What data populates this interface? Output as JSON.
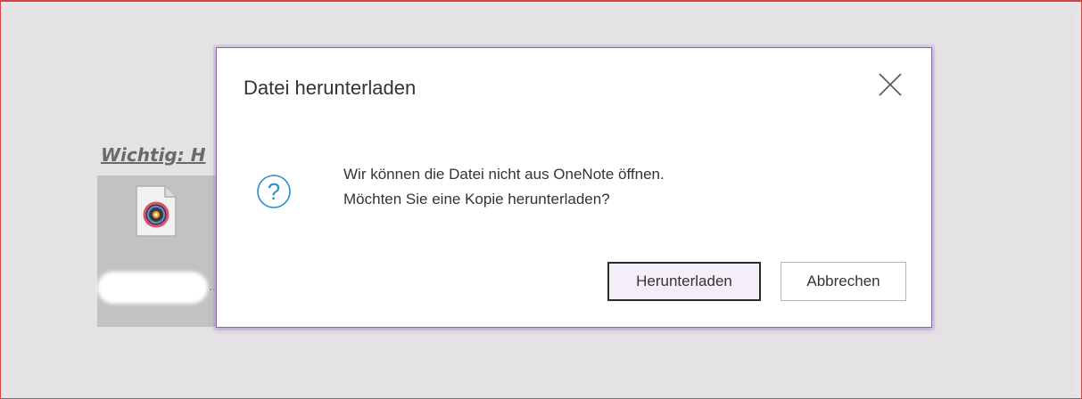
{
  "background": {
    "note_heading": "Wichtig: H",
    "attachment_ellipsis": "..."
  },
  "dialog": {
    "title": "Datei herunterladen",
    "close_icon": "close-icon",
    "status_icon": "question-circle-icon",
    "message_line1": "Wir können die Datei nicht aus OneNote öffnen.",
    "message_line2": "Möchten Sie eine Kopie herunterladen?",
    "primary_button_label": "Herunterladen",
    "secondary_button_label": "Abbrechen"
  },
  "colors": {
    "dialog_border": "#8c63b0",
    "question_icon": "#2a8fcf",
    "primary_button_fill": "#f4eef9",
    "page_frame_border": "#d64545"
  }
}
